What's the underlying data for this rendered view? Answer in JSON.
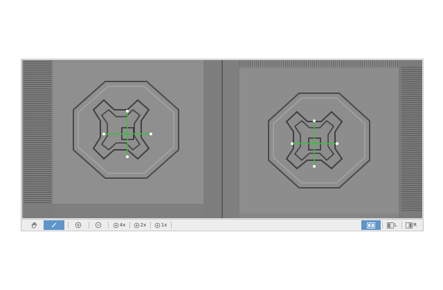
{
  "toolbar": {
    "tools": [
      {
        "icon": "hand-icon"
      },
      {
        "icon": "pen-icon",
        "active": true
      }
    ],
    "zoom": [
      {
        "icon": "zoom-in-icon"
      },
      {
        "icon": "zoom-out-icon"
      },
      {
        "icon": "zoom-in-icon",
        "label": "4x"
      },
      {
        "icon": "zoom-in-icon",
        "label": "2x"
      },
      {
        "icon": "zoom-in-icon",
        "label": "1x"
      }
    ],
    "view_modes": [
      {
        "icon": "split-view-icon",
        "active": true
      },
      {
        "icon": "left-view-icon",
        "label": "L"
      },
      {
        "icon": "right-view-icon",
        "label": "R"
      }
    ]
  },
  "colors": {
    "accent": "#5f95c8",
    "marker": "#35c43a",
    "image_bg": "#8b8b8b"
  },
  "panes": [
    {
      "name": "left-image",
      "marker": "green-crosshair"
    },
    {
      "name": "right-image",
      "marker": "green-crosshair"
    }
  ]
}
